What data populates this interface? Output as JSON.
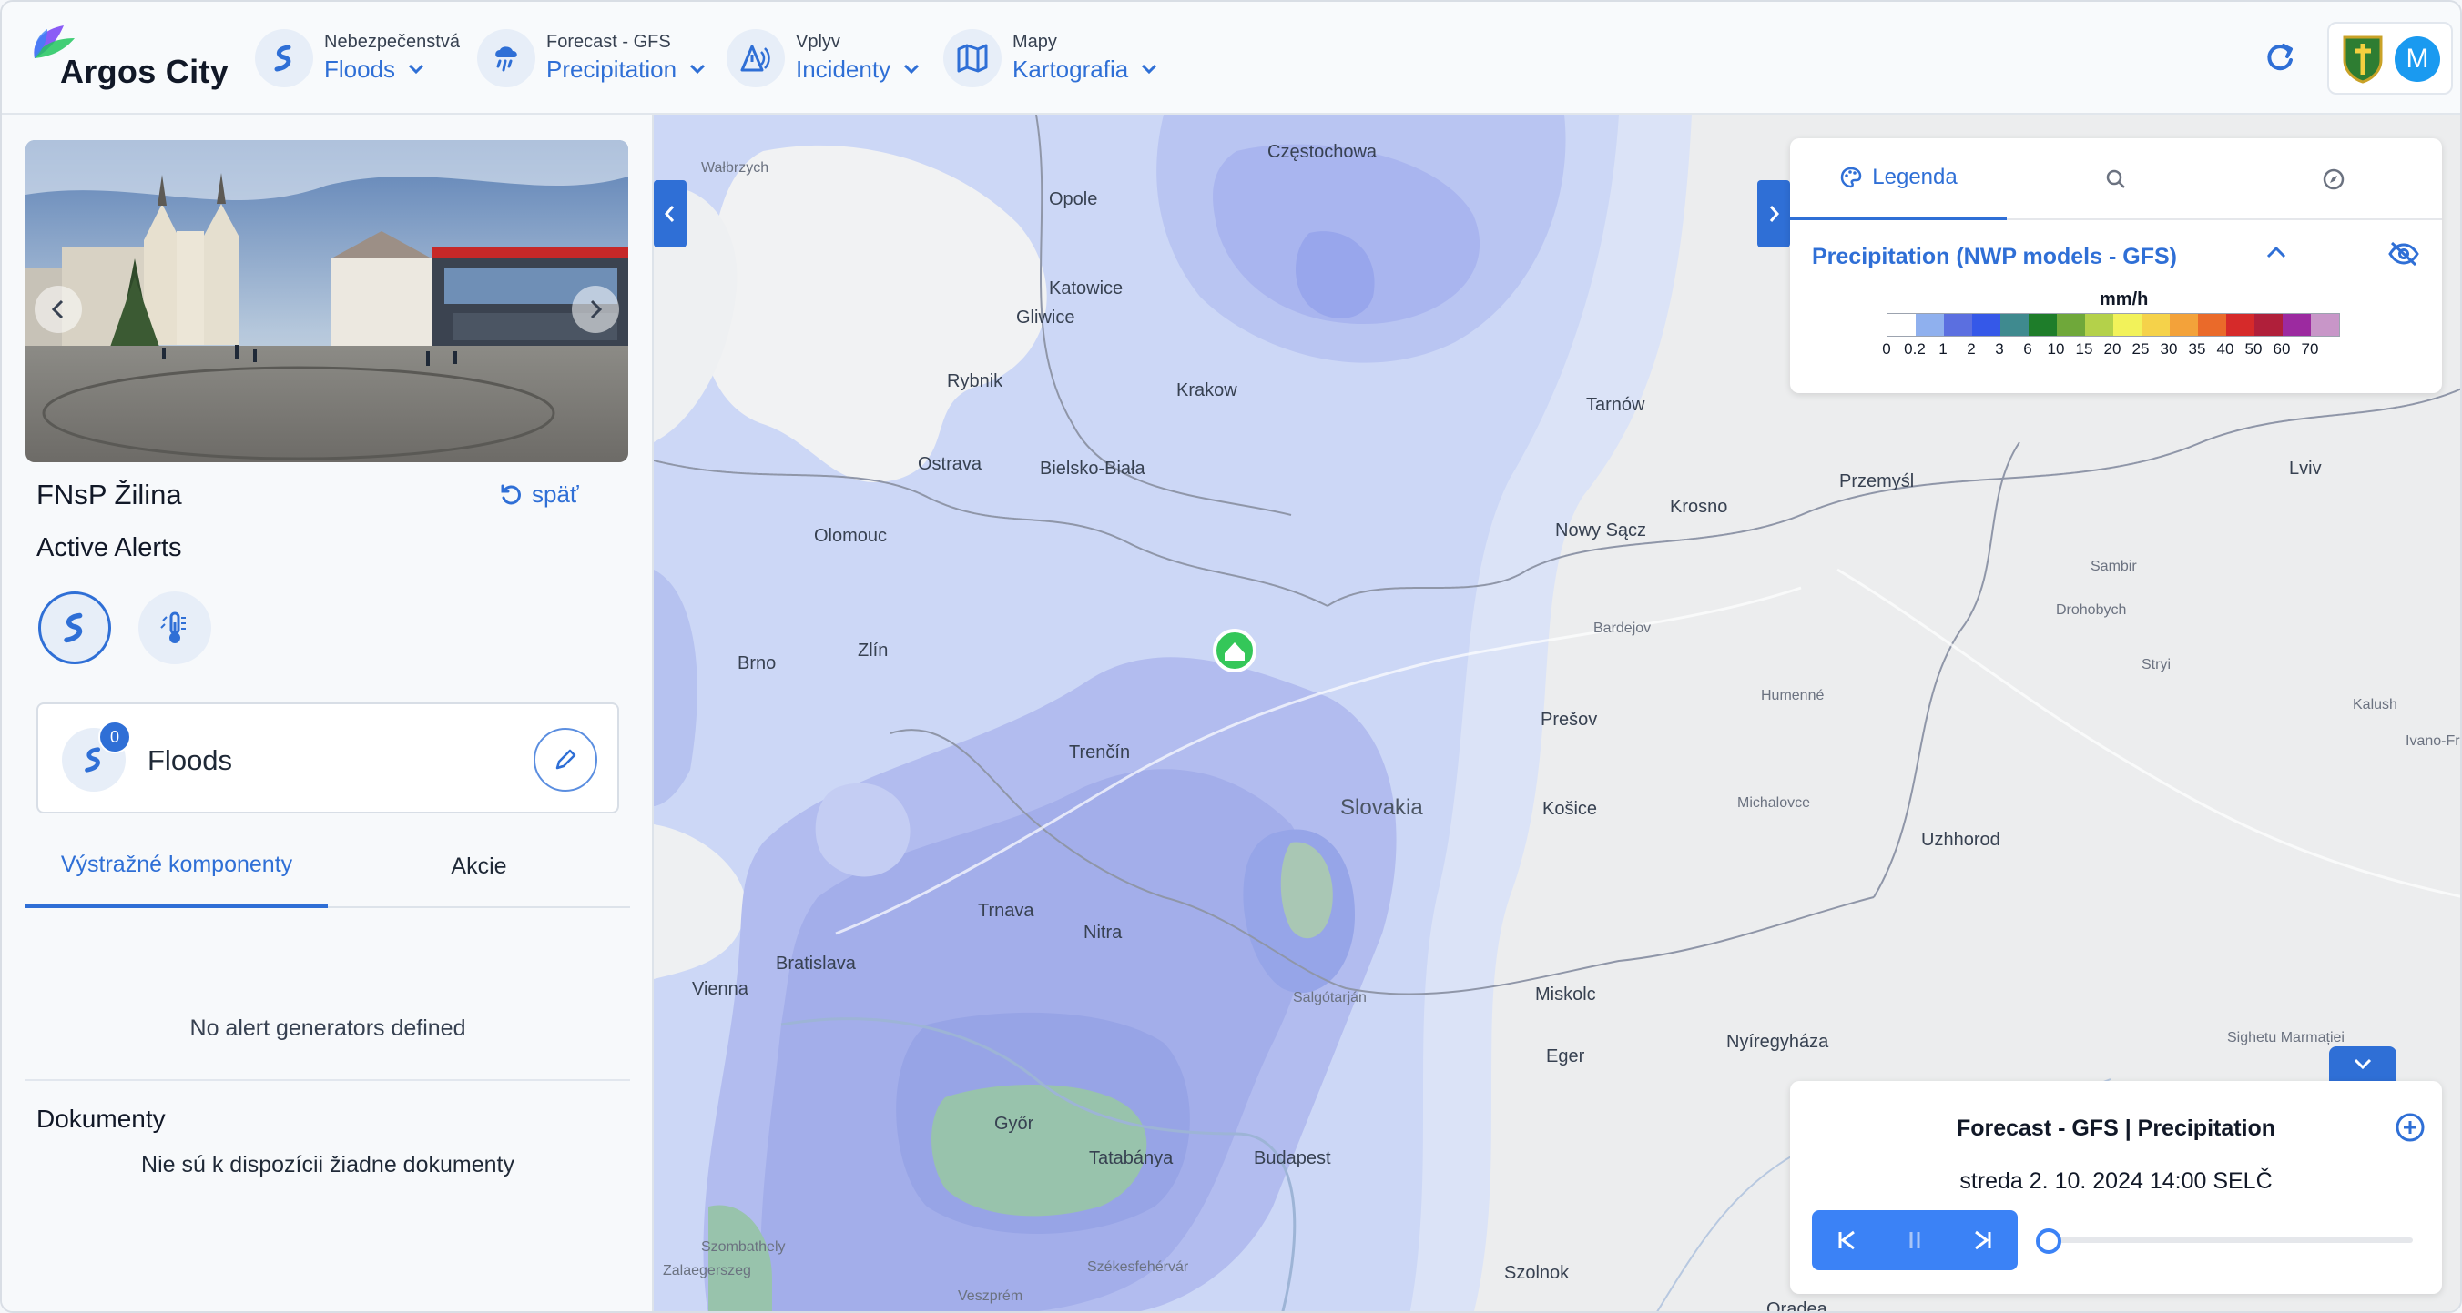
{
  "app": {
    "title": "Argos City"
  },
  "nav": [
    {
      "small": "Nebezpečenstvá",
      "main": "Floods",
      "icon": "flood-icon"
    },
    {
      "small": "Forecast - GFS",
      "main": "Precipitation",
      "icon": "precipitation-icon"
    },
    {
      "small": "Vplyv",
      "main": "Incidenty",
      "icon": "incident-icon"
    },
    {
      "small": "Mapy",
      "main": "Kartografia",
      "icon": "map-icon"
    }
  ],
  "user": {
    "initial": "M"
  },
  "sidebar": {
    "place_name": "FNsP Žilina",
    "back_label": "späť",
    "active_alerts_title": "Active Alerts",
    "alert_card": {
      "label": "Floods",
      "badge": "0"
    },
    "tabs": [
      "Výstražné komponenty",
      "Akcie"
    ],
    "no_generators": "No alert generators defined",
    "documents_title": "Dokumenty",
    "documents_empty": "Nie sú k dispozícii žiadne dokumenty"
  },
  "legend": {
    "tabs": [
      "Legenda",
      "",
      ""
    ],
    "layer_title": "Precipitation (NWP models - GFS)",
    "unit": "mm/h",
    "colors": [
      "#ffffff",
      "#8fb0ee",
      "#5b6fe0",
      "#3558e8",
      "#3f8a8f",
      "#1e7d2a",
      "#6fa83a",
      "#b4d14a",
      "#f2f25a",
      "#f5d24a",
      "#f3a23a",
      "#ea6a2a",
      "#d62a2a",
      "#b01f3a",
      "#9c2aa0",
      "#c896c8"
    ],
    "ticks": [
      "0",
      "0.2",
      "1",
      "2",
      "3",
      "6",
      "10",
      "15",
      "20",
      "25",
      "30",
      "35",
      "40",
      "50",
      "60",
      "70"
    ]
  },
  "forecast": {
    "title": "Forecast - GFS | Precipitation",
    "datetime": "streda 2. 10. 2024 14:00 SELČ"
  },
  "map_labels": {
    "country": "Slovakia",
    "cities_big": [
      "Bratislava",
      "Vienna",
      "Budapest",
      "Brno",
      "Ostrava",
      "Krakow",
      "Katowice",
      "Košice",
      "Prešov",
      "Olomouc",
      "Zlín",
      "Trenčín",
      "Nitra",
      "Trnava",
      "Uzhhorod",
      "Miskolc",
      "Nyíregyháza",
      "Gliwice",
      "Rybnik",
      "Bielsko-Biała",
      "Tarnów",
      "Krosno",
      "Przemyśl",
      "Lviv",
      "Nowy Sącz",
      "Szolnok",
      "Tatabánya",
      "Győr",
      "Eger",
      "Oradea",
      "Częstochowa",
      "Opole",
      "Wałbrzych",
      "Bardejov",
      "Humenné",
      "Michalovce",
      "Salgótarján",
      "Ivano-Frankivsk",
      "Sighetu Marmației",
      "Zalaegerszeg",
      "Szombathely",
      "Veszprém",
      "Székesfehérvár",
      "Kalush",
      "Drohobych",
      "Sambir",
      "Stryi"
    ]
  }
}
